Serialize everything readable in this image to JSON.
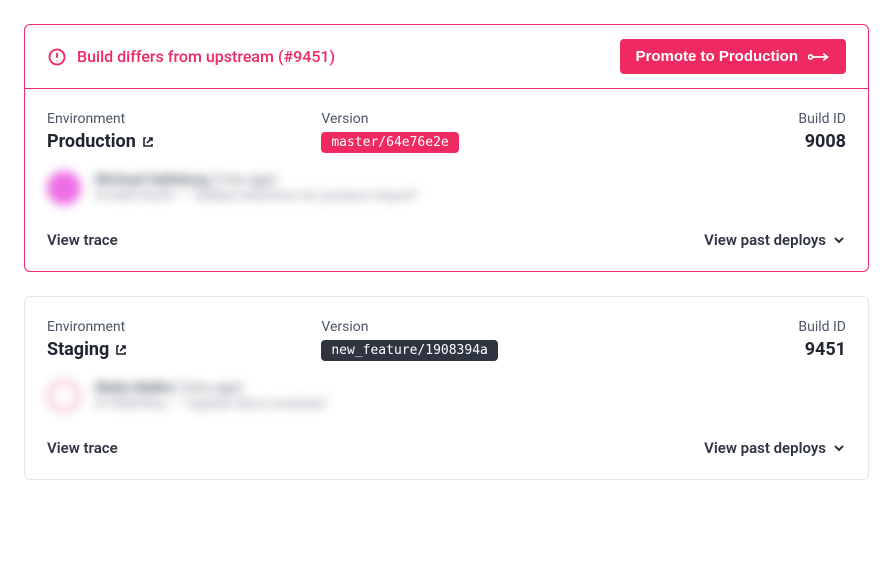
{
  "alert": {
    "text": "Build differs from upstream (#9451)",
    "button": "Promote to Production"
  },
  "labels": {
    "environment": "Environment",
    "version": "Version",
    "build_id": "Build ID",
    "view_trace": "View trace",
    "view_past": "View past deploys"
  },
  "envs": [
    {
      "name": "Production",
      "version": "master/64e76e2e",
      "version_style": "red",
      "build_id": "9008",
      "highlighted": true,
      "avatar": "pink",
      "commit_author": "Michael Hylleberg",
      "commit_time": "(1mo ago)",
      "commit_hash": "#1e8476e24",
      "commit_msg": "\"Added reference for product import\""
    },
    {
      "name": "Staging",
      "version": "new_feature/1908394a",
      "version_style": "dark",
      "build_id": "9451",
      "highlighted": false,
      "avatar": "ring",
      "commit_author": "Malte Møller",
      "commit_time": "(1mo ago)",
      "commit_hash": "#190839ea",
      "commit_msg": "\"Update deco-modules\""
    }
  ]
}
